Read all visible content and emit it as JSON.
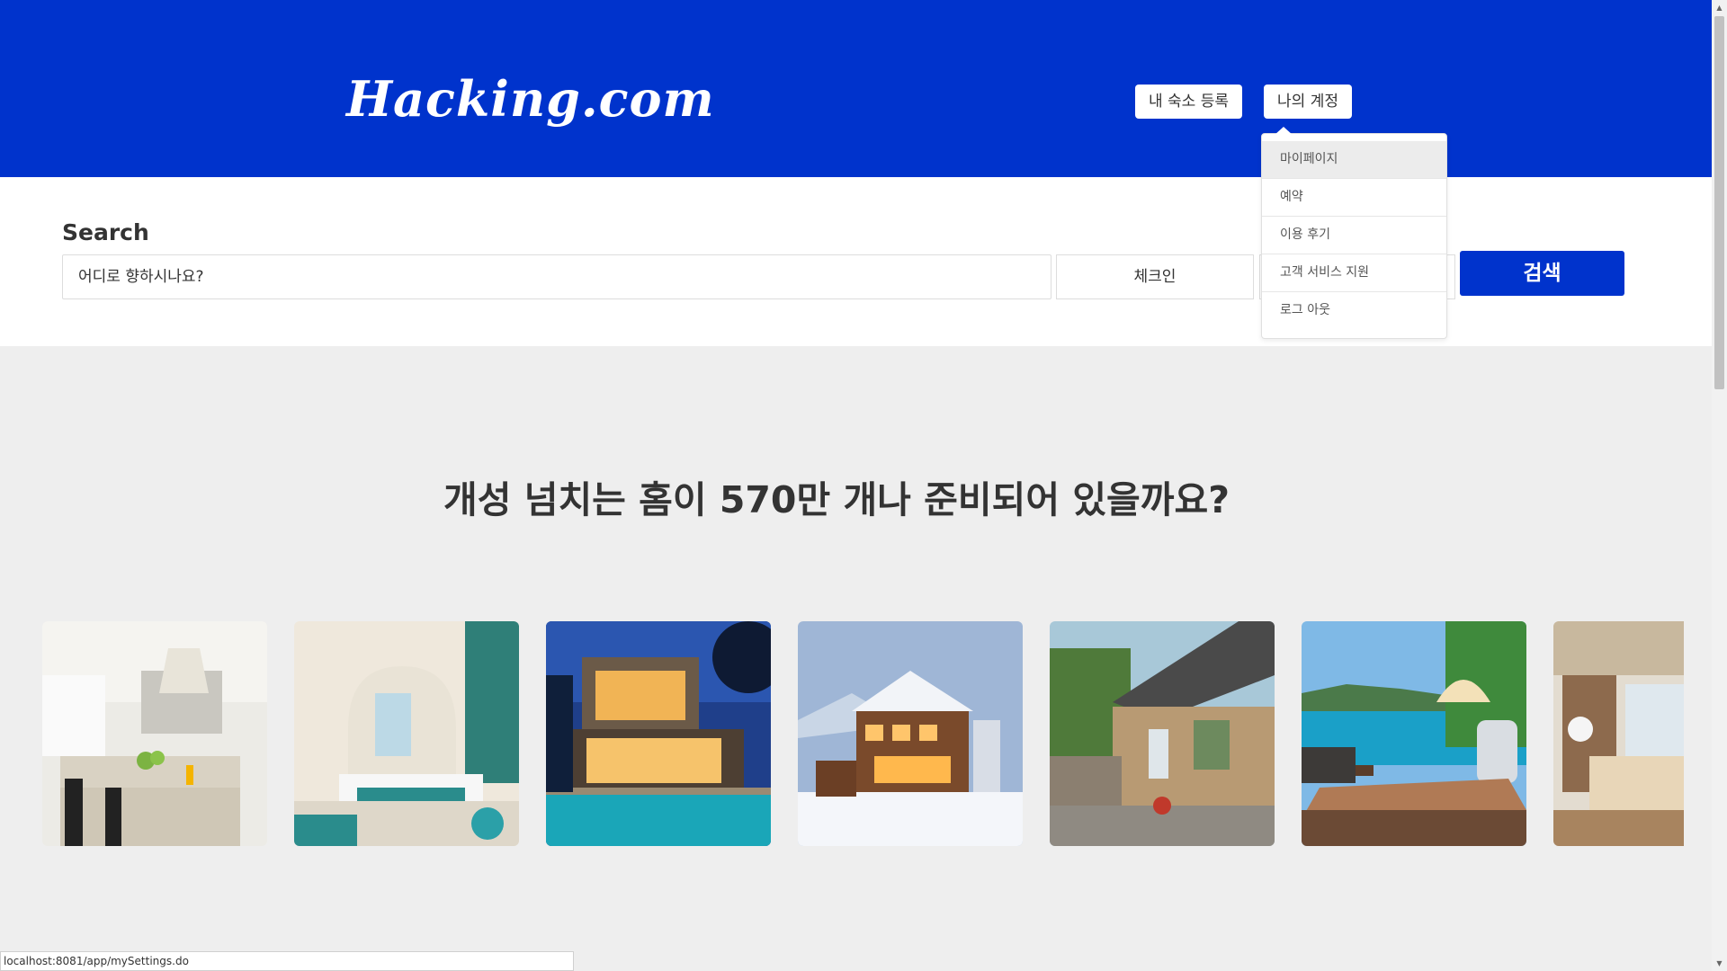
{
  "header": {
    "logo": "Hacking.com",
    "register_button": "내 숙소 등록",
    "account_button": "나의 계정"
  },
  "account_menu": {
    "items": [
      {
        "label": "마이페이지",
        "active": true
      },
      {
        "label": "예약"
      },
      {
        "label": "이용 후기"
      },
      {
        "label": "고객 서비스 지원"
      },
      {
        "label": "로그 아웃"
      }
    ]
  },
  "search": {
    "title": "Search",
    "destination_placeholder": "어디로 향하시나요?",
    "checkin_label": "체크인",
    "checkout_label": "",
    "button_label": "검색"
  },
  "main": {
    "headline": "개성 넘치는 홈이 570만 개나 준비되어 있을까요?"
  },
  "gallery": {
    "images": [
      "modern-kitchen-photo",
      "hotel-bedroom-photo",
      "modern-house-pool-photo",
      "snowy-chalet-photo",
      "stone-cottage-photo",
      "seaside-deck-photo",
      "living-room-photo"
    ]
  },
  "status_bar": {
    "url": "localhost:8081/app/mySettings.do"
  },
  "colors": {
    "brand_blue": "#0033cc",
    "page_background": "#eeeeee"
  }
}
